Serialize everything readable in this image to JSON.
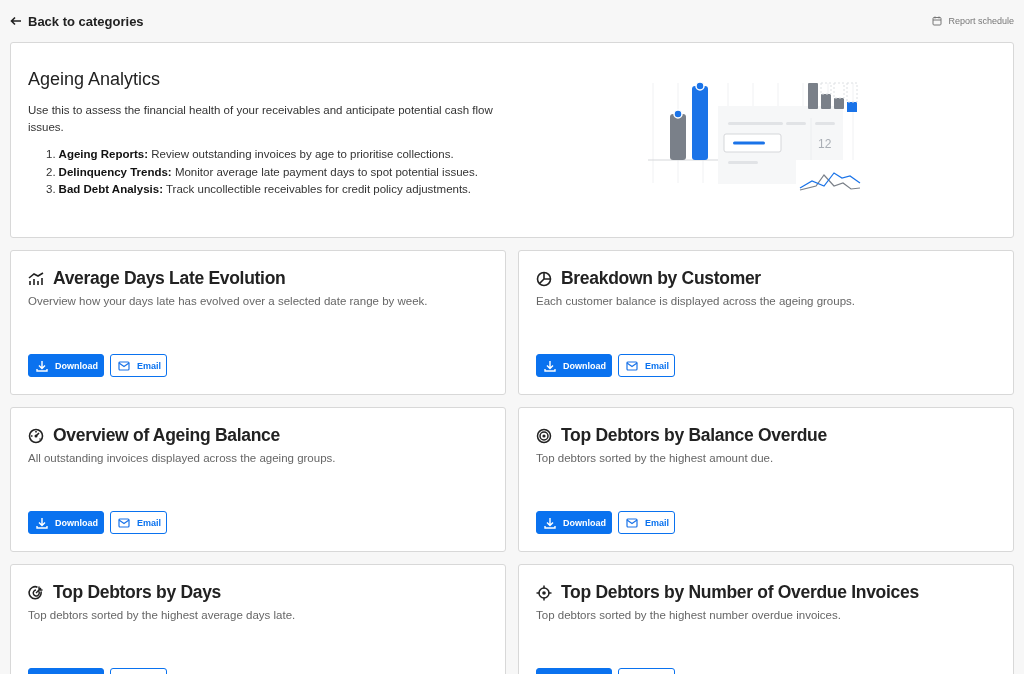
{
  "header": {
    "back_link": "Back to categories",
    "schedule_link": "Report schedule"
  },
  "hero": {
    "title": "Ageing Analytics",
    "intro": "Use this to assess the financial health of your receivables and anticipate potential cash flow issues.",
    "points": [
      {
        "number": "1.",
        "text": "**Ageing Reports:** Review outstanding invoices by age to prioritise collections."
      },
      {
        "number": "2.",
        "text": "**Delinquency Trends:** Monitor average late payment days to spot potential issues."
      },
      {
        "number": "3.",
        "text": "**Bad Debt Analysis:** Track uncollectible receivables for credit policy adjustments."
      }
    ],
    "illustration_number": "12"
  },
  "reports": [
    {
      "kind": "trend",
      "title": "Average Days Late Evolution",
      "description": "Overview how your days late has evolved over a selected date range by week.",
      "actions": [
        {
          "kind": "download",
          "label": "Download"
        },
        {
          "kind": "email",
          "label": "Email"
        }
      ]
    },
    {
      "kind": "pie",
      "title": "Breakdown by Customer",
      "description": "Each customer balance is displayed across the ageing groups.",
      "actions": [
        {
          "kind": "download",
          "label": "Download"
        },
        {
          "kind": "email",
          "label": "Email"
        }
      ]
    },
    {
      "kind": "gauge",
      "title": "Overview of Ageing Balance",
      "description": "All outstanding invoices displayed across the ageing groups.",
      "actions": [
        {
          "kind": "download",
          "label": "Download"
        },
        {
          "kind": "email",
          "label": "Email"
        }
      ]
    },
    {
      "kind": "target",
      "title": "Top Debtors by Balance Overdue",
      "description": "Top debtors sorted by the highest amount due.",
      "actions": [
        {
          "kind": "download",
          "label": "Download"
        },
        {
          "kind": "email",
          "label": "Email"
        }
      ]
    },
    {
      "kind": "progress",
      "title": "Top Debtors by Days",
      "description": "Top debtors sorted by the highest average days late.",
      "actions": [
        {
          "kind": "download"
        },
        {
          "kind": "email"
        }
      ]
    },
    {
      "kind": "crosshair",
      "title": "Top Debtors by Number of Overdue Invoices",
      "description": "Top debtors sorted by the highest number overdue invoices.",
      "actions": [
        {
          "kind": "download"
        },
        {
          "kind": "email"
        }
      ]
    }
  ]
}
